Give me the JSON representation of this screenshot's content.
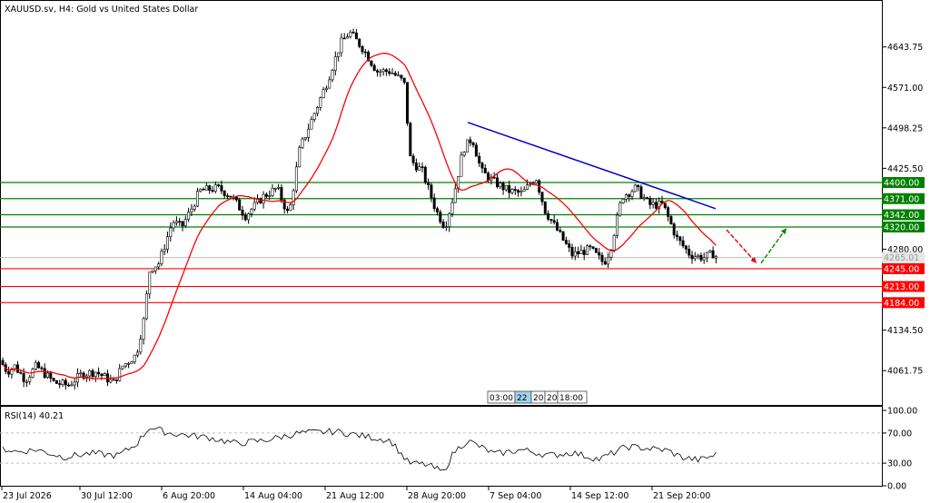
{
  "header": {
    "title": "XAUUSD.sv, H4:  Gold vs United States Dollar"
  },
  "chart_data": {
    "type": "candlestick",
    "symbol": "XAUUSD.sv",
    "timeframe": "H4",
    "description": "Gold vs United States Dollar",
    "price_axis": {
      "ticks": [
        4643.75,
        4571.0,
        4498.25,
        4425.5,
        4280.0,
        4134.5,
        4061.75
      ],
      "range": [
        4000,
        4720
      ]
    },
    "time_axis": {
      "labels": [
        "23 Jul 2026",
        "30 Jul 12:00",
        "6 Aug 20:00",
        "14 Aug 04:00",
        "21 Aug 12:00",
        "28 Aug 20:00",
        "7 Sep 04:00",
        "14 Sep 12:00",
        "21 Sep 20:00"
      ]
    },
    "current_price": "4265.01",
    "support_levels": [
      {
        "label": "4245.00",
        "value": 4245.0
      },
      {
        "label": "4213.00",
        "value": 4213.0
      },
      {
        "label": "4184.00",
        "value": 4184.0
      }
    ],
    "resistance_levels": [
      {
        "label": "4400.00",
        "value": 4400.0
      },
      {
        "label": "4371.00",
        "value": 4371.0
      },
      {
        "label": "4342.00",
        "value": 4342.0
      },
      {
        "label": "4320.00",
        "value": 4320.0
      }
    ],
    "moving_average": {
      "color": "#ff0000"
    },
    "trendline": {
      "color": "#0000cc"
    },
    "scenario_arrows": [
      {
        "direction": "down",
        "color": "#e00000"
      },
      {
        "direction": "up",
        "color": "#008800"
      }
    ],
    "scroll_labels": [
      "03:00",
      "22",
      "20",
      "20",
      "18:00"
    ],
    "rsi": {
      "label": "RSI(14) 40.21",
      "period": 14,
      "value": 40.21,
      "ticks": [
        "100.00",
        "70.00",
        "30.00",
        "0.00"
      ],
      "levels": [
        70,
        30
      ]
    },
    "colors": {
      "support": "#ff0000",
      "resistance": "#008000",
      "candle": "#000000",
      "grid": "#c0c0c0"
    }
  }
}
